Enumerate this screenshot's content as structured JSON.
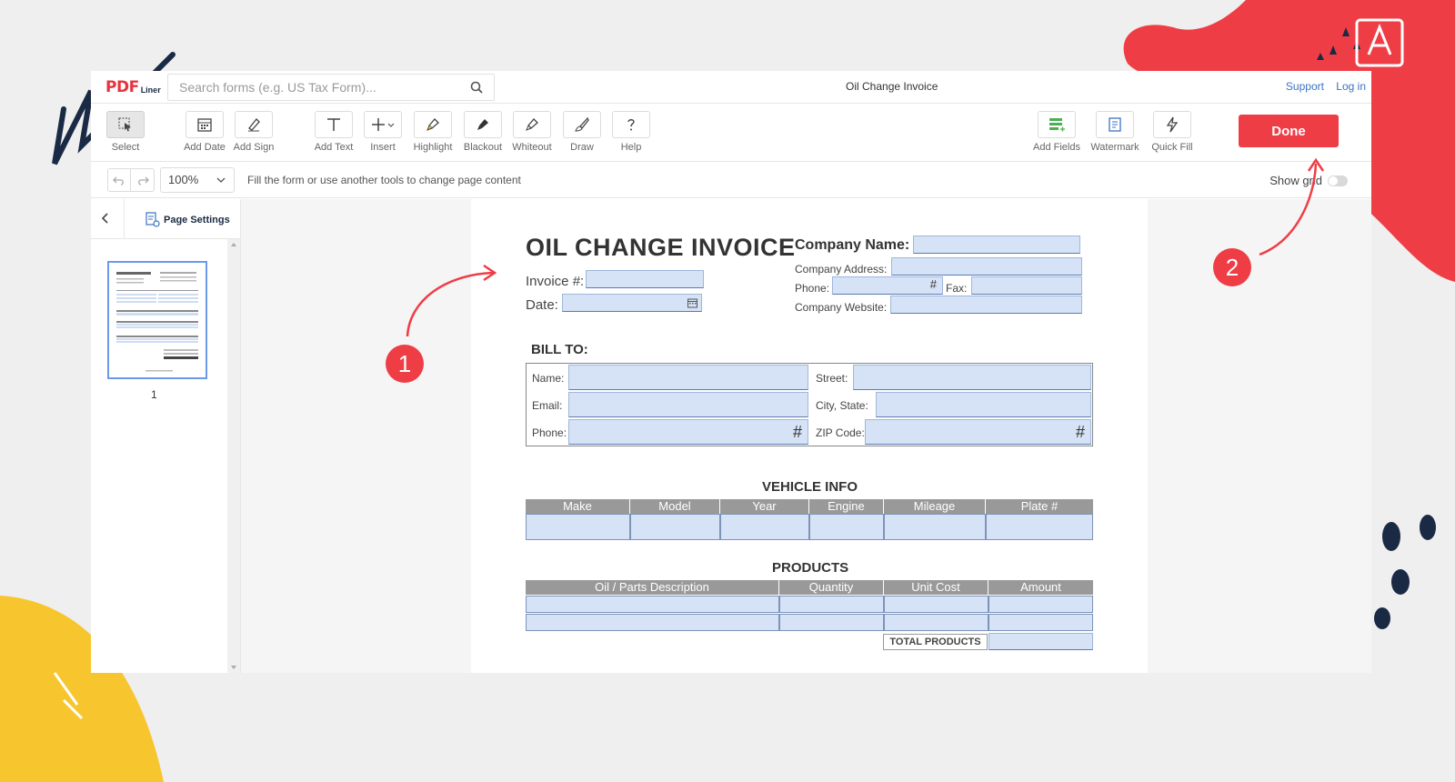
{
  "header": {
    "logo_pdf": "PDF",
    "logo_liner": "Liner",
    "search_placeholder": "Search forms (e.g. US Tax Form)...",
    "document_title": "Oil Change Invoice",
    "links": {
      "support": "Support",
      "login": "Log in"
    }
  },
  "toolbar": {
    "tools": [
      {
        "label": "Select",
        "icon": "select-icon"
      },
      {
        "label": "Add Date",
        "icon": "calendar-icon"
      },
      {
        "label": "Add Sign",
        "icon": "signature-icon"
      },
      {
        "label": "Add Text",
        "icon": "text-icon"
      },
      {
        "label": "Insert",
        "icon": "plus-icon"
      },
      {
        "label": "Highlight",
        "icon": "highlighter-icon"
      },
      {
        "label": "Blackout",
        "icon": "blackout-icon"
      },
      {
        "label": "Whiteout",
        "icon": "eraser-icon"
      },
      {
        "label": "Draw",
        "icon": "brush-icon"
      },
      {
        "label": "Help",
        "icon": "question-icon"
      }
    ],
    "right_tools": [
      {
        "label": "Add Fields",
        "icon": "fields-icon"
      },
      {
        "label": "Watermark",
        "icon": "watermark-icon"
      },
      {
        "label": "Quick Fill",
        "icon": "lightning-icon"
      }
    ],
    "done_label": "Done"
  },
  "subbar": {
    "zoom": "100%",
    "hint": "Fill the form or use another tools to change page content",
    "show_grid": "Show grid",
    "show_grid_on": false
  },
  "sidebar": {
    "page_settings": "Page Settings",
    "page_number": "1"
  },
  "form": {
    "title": "OIL CHANGE INVOICE",
    "invoice_label": "Invoice #:",
    "date_label": "Date:",
    "company_name_label": "Company Name:",
    "company_address_label": "Company Address:",
    "phone_label": "Phone:",
    "fax_label": "Fax:",
    "company_website_label": "Company Website:",
    "bill_to": {
      "title": "BILL TO:",
      "name": "Name:",
      "street": "Street:",
      "email": "Email:",
      "city_state": "City, State:",
      "phone": "Phone:",
      "zip": "ZIP Code:",
      "hash": "#"
    },
    "vehicle": {
      "title": "VEHICLE INFO",
      "columns": [
        "Make",
        "Model",
        "Year",
        "Engine",
        "Mileage",
        "Plate #"
      ]
    },
    "products": {
      "title": "PRODUCTS",
      "columns": [
        "Oil / Parts Description",
        "Quantity",
        "Unit Cost",
        "Amount"
      ],
      "total_label": "TOTAL PRODUCTS"
    }
  },
  "annotations": {
    "first": "1",
    "second": "2"
  },
  "colors": {
    "accent": "#ef3d46",
    "field_fill": "#d6e3f7",
    "brand_navy": "#1b2a44",
    "highlight_yellow": "#f7c62f"
  }
}
